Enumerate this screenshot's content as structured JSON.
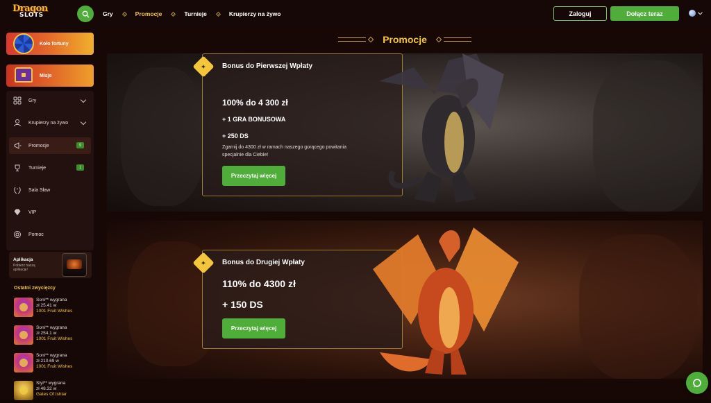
{
  "brand": {
    "logo_line1": "Dragon",
    "logo_line2": "SLOTS"
  },
  "header": {
    "nav": [
      {
        "label": "Gry",
        "active": false
      },
      {
        "label": "Promocje",
        "active": true
      },
      {
        "label": "Turnieje",
        "active": false
      },
      {
        "label": "Krupierzy na żywo",
        "active": false
      }
    ],
    "login_label": "Zaloguj",
    "join_label": "Dołącz teraz"
  },
  "sidebar": {
    "wheel_label": "Koło fortuny",
    "missions_label": "Misje",
    "menu": [
      {
        "label": "Gry",
        "icon": "games-icon",
        "has_chevron": true
      },
      {
        "label": "Krupierzy na żywo",
        "icon": "live-dealer-icon",
        "has_chevron": true
      },
      {
        "label": "Promocje",
        "icon": "megaphone-icon",
        "badge": "9",
        "active": true
      },
      {
        "label": "Turnieje",
        "icon": "tournament-icon",
        "badge": "1"
      },
      {
        "label": "Sala Sław",
        "icon": "laurel-icon"
      },
      {
        "label": "VIP",
        "icon": "diamond-icon"
      },
      {
        "label": "Pomoc",
        "icon": "help-icon"
      }
    ],
    "app": {
      "title": "Aplikacja",
      "subtitle": "Pobierz naszą aplikację!"
    },
    "winners_title": "Ostatni zwycięzcy",
    "winners": [
      {
        "name": "Soni** wygrana",
        "amount": "zł 25.41 w",
        "game": "1001 Fruit Wishes"
      },
      {
        "name": "Soni** wygrana",
        "amount": "zł 254.1 w",
        "game": "1001 Fruit Wishes"
      },
      {
        "name": "Soni** wygrana",
        "amount": "zł 210.69 w",
        "game": "1001 Fruit Wishes"
      },
      {
        "name": "Styl** wygrana",
        "amount": "zł 48.32 w",
        "game": "Gates Of Ishtar"
      }
    ]
  },
  "main": {
    "section_title": "Promocje",
    "promos": [
      {
        "title": "Bonus do Pierwszej Wpłaty",
        "line1": "100% do 4 300 zł",
        "line2": "+ 1 GRA BONUSOWA",
        "line3": "+ 250 DS",
        "description": "Zgarnij do 4300 zł w ramach naszego gorącego powitania specjalnie dla Ciebie!",
        "button": "Przeczytaj więcej"
      },
      {
        "title": "Bonus do Drugiej Wpłaty",
        "line1": "110% do 4300 zł",
        "line2": "+ 150 DS",
        "button": "Przeczytaj więcej"
      }
    ]
  },
  "colors": {
    "accent_green": "#4fae3a",
    "accent_gold": "#f3c63b",
    "background": "#170806"
  }
}
